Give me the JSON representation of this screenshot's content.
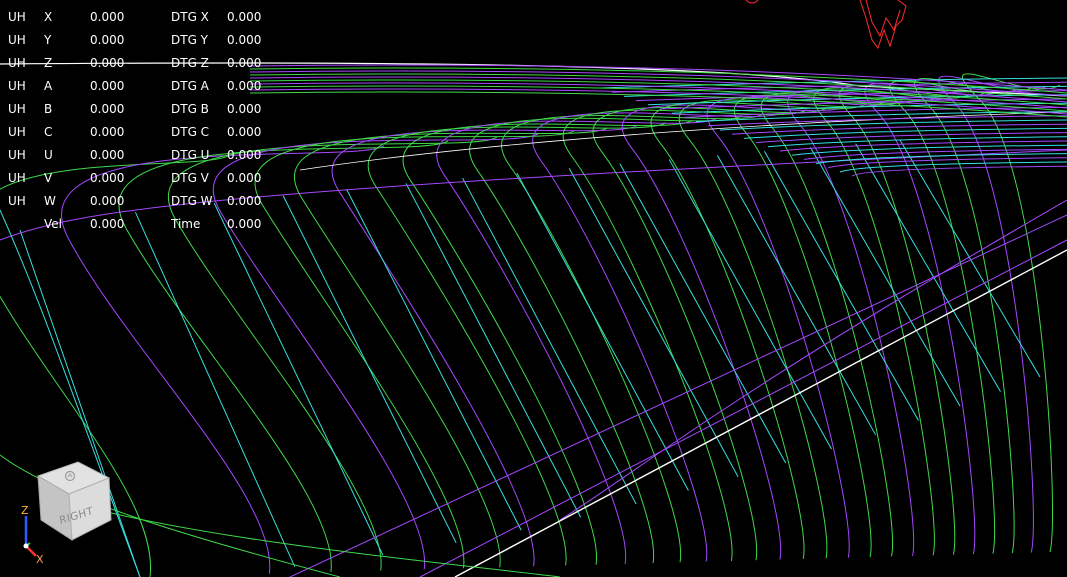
{
  "dro": {
    "rows": [
      {
        "mode": "UH",
        "axis": "X",
        "value": "0.000",
        "dtg_label": "DTG X",
        "dtg_value": "0.000"
      },
      {
        "mode": "UH",
        "axis": "Y",
        "value": "0.000",
        "dtg_label": "DTG Y",
        "dtg_value": "0.000"
      },
      {
        "mode": "UH",
        "axis": "Z",
        "value": "0.000",
        "dtg_label": "DTG Z",
        "dtg_value": "0.000"
      },
      {
        "mode": "UH",
        "axis": "A",
        "value": "0.000",
        "dtg_label": "DTG A",
        "dtg_value": "0.000"
      },
      {
        "mode": "UH",
        "axis": "B",
        "value": "0.000",
        "dtg_label": "DTG B",
        "dtg_value": "0.000"
      },
      {
        "mode": "UH",
        "axis": "C",
        "value": "0.000",
        "dtg_label": "DTG C",
        "dtg_value": "0.000"
      },
      {
        "mode": "UH",
        "axis": "U",
        "value": "0.000",
        "dtg_label": "DTG U",
        "dtg_value": "0.000"
      },
      {
        "mode": "UH",
        "axis": "V",
        "value": "0.000",
        "dtg_label": "DTG V",
        "dtg_value": "0.000"
      },
      {
        "mode": "UH",
        "axis": "W",
        "value": "0.000",
        "dtg_label": "DTG W",
        "dtg_value": "0.000"
      },
      {
        "mode": "",
        "axis": "Vel",
        "value": "0.000",
        "dtg_label": "Time",
        "dtg_value": "0.000"
      }
    ]
  },
  "view_cube": {
    "face_label": "RIGHT",
    "top_icon": "home-icon"
  },
  "axis_triad": {
    "z_label": "Z",
    "x_label": "X",
    "z_color": "#2e5bff",
    "x_color": "#ff3030",
    "z_label_color": "#ffb020",
    "x_label_color": "#ff9a50"
  },
  "colors": {
    "background": "#000000",
    "dro_text": "#ffffff",
    "path_green": "#3fd94a",
    "path_purple": "#a548ff",
    "path_cyan": "#35e0e0",
    "path_white": "#ffffff",
    "tool_red": "#ff2a2a"
  }
}
